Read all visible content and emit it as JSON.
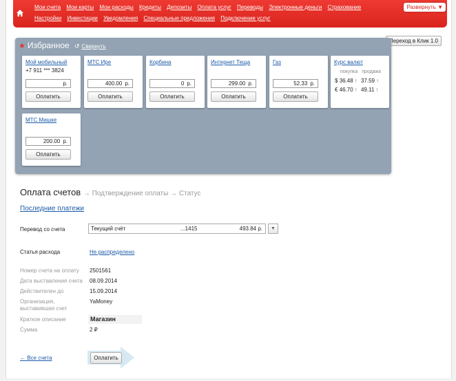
{
  "nav": {
    "row1": [
      "Мои счета",
      "Мои карты",
      "Мои расходы",
      "Кредиты",
      "Депозиты",
      "Оплата услуг",
      "Переводы",
      "Электронные деньги",
      "Страхование"
    ],
    "row2": [
      "Настройки",
      "Инвестиции",
      "Уведомления",
      "Специальные предложения",
      "Подключение услуг"
    ],
    "expand_label": "Развернуть ▼"
  },
  "switch_label": "Переход в Клик 1.0",
  "favorites": {
    "title": "Избранное",
    "collapse_label": "Свернуть",
    "cards": [
      {
        "title": "Мой мобильный",
        "sub": "+7 911 *** 3824",
        "amount": "",
        "currency": "р.",
        "button": "Оплатить"
      },
      {
        "title": "МТС Ире",
        "amount": "400.00",
        "currency": "р.",
        "button": "Оплатить"
      },
      {
        "title": "Корбина",
        "amount": "0",
        "currency": "р.",
        "button": "Оплатить"
      },
      {
        "title": "Интернет Теща",
        "amount": "299.00",
        "currency": "р.",
        "button": "Оплатить"
      },
      {
        "title": "Газ",
        "amount": "52.33",
        "currency": "р.",
        "button": "Оплатить"
      },
      {
        "title": "МТС Мишке",
        "amount": "200.00",
        "currency": "р.",
        "button": "Оплатить"
      }
    ],
    "rates": {
      "title": "Курс валют",
      "buy_label": "покупка",
      "sell_label": "продажа",
      "usd": {
        "symbol": "$",
        "buy": "36.48",
        "sell": "37.59"
      },
      "eur": {
        "symbol": "€",
        "buy": "46.70",
        "sell": "49.11"
      }
    }
  },
  "payment": {
    "title": "Оплата счетов",
    "steps": "→ Подтверждение оплаты → Статус",
    "recent_label": "Последние платежи",
    "from_label": "Перевод со счета",
    "account_name": "Текущий счёт",
    "account_number": "...1415",
    "account_balance": "493.84 р.",
    "category_label": "Статья расхода",
    "category_value": "Не распределено",
    "invoice_number_label": "Номер счета на оплату",
    "invoice_number": "2501561",
    "invoice_date_label": "Дата выставления счета",
    "invoice_date": "08.09.2014",
    "valid_until_label": "Действителен до",
    "valid_until": "15.09.2014",
    "org_label": "Организация, выставившая счет",
    "org_value": "YaMoney",
    "desc_label": "Краткое описание",
    "desc_value": "Магазин",
    "sum_label": "Сумма",
    "sum_value": "2 ₽",
    "back_label": "← Все счета",
    "submit_label": "Оплатить"
  }
}
